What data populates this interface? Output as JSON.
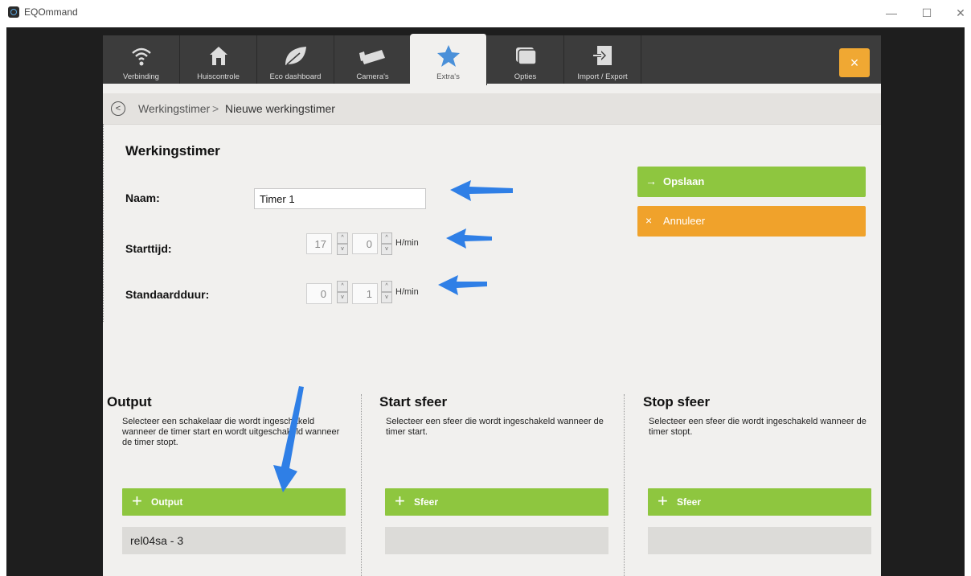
{
  "window": {
    "title": "EQOmmand",
    "minimize": "—",
    "maximize": "☐",
    "close": "✕"
  },
  "nav": {
    "tabs": [
      {
        "label": "Verbinding",
        "icon": "wifi-icon"
      },
      {
        "label": "Huiscontrole",
        "icon": "home-icon"
      },
      {
        "label": "Eco dashboard",
        "icon": "leaf-icon"
      },
      {
        "label": "Camera's",
        "icon": "camera-icon"
      },
      {
        "label": "Extra's",
        "icon": "star-icon",
        "active": true
      },
      {
        "label": "Opties",
        "icon": "options-icon"
      },
      {
        "label": "Import / Export",
        "icon": "import-icon"
      }
    ],
    "close_icon": "×"
  },
  "breadcrumb": {
    "back": "<",
    "parent": "Werkingstimer",
    "separator": ">",
    "current": "Nieuwe werkingstimer"
  },
  "form": {
    "title": "Werkingstimer",
    "naam_label": "Naam:",
    "naam_value": "Timer 1",
    "starttijd_label": "Starttijd:",
    "starttijd_hours": "17",
    "starttijd_minutes": "0",
    "standaardduur_label": "Standaardduur:",
    "standaardduur_hours": "0",
    "standaardduur_minutes": "1",
    "unit": "H/min",
    "spin_up": "^",
    "spin_down": "v"
  },
  "actions": {
    "save_icon": "→",
    "save_label": "Opslaan",
    "cancel_icon": "×",
    "cancel_label": "Annuleer"
  },
  "columns": [
    {
      "title": "Output",
      "description": "Selecteer een schakelaar die wordt ingeschakeld wanneer de timer start en wordt uitgeschakeld wanneer de timer stopt.",
      "button_label": "Output",
      "value": "rel04sa - 3"
    },
    {
      "title": "Start sfeer",
      "description": "Selecteer een sfeer die wordt ingeschakeld wanneer de timer start.",
      "button_label": "Sfeer",
      "value": ""
    },
    {
      "title": "Stop sfeer",
      "description": "Selecteer een sfeer die wordt ingeschakeld wanneer de timer stopt.",
      "button_label": "Sfeer",
      "value": ""
    }
  ],
  "colors": {
    "green": "#8ec63f",
    "orange": "#f0a22b",
    "nav_bg": "#3c3c3c",
    "annotation": "#2f7fe6"
  }
}
